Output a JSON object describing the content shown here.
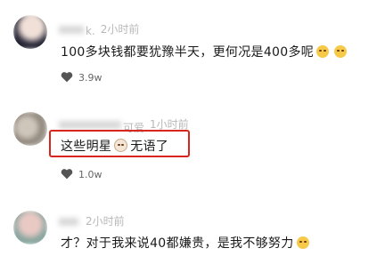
{
  "comments": [
    {
      "name": "k.",
      "time": "2小时前",
      "text_before": "100多块钱都要犹豫半天，更何况是400多呢",
      "text_after": "",
      "emojis": [
        "laugh-cry-emoji",
        "laugh-cry-emoji"
      ],
      "likes": "3.9w"
    },
    {
      "name": "可爱",
      "time": "1小时前",
      "text_before": "这些明星",
      "text_after": "无语了",
      "emojis": [
        "cat-emoji"
      ],
      "likes": "1.0w",
      "highlighted": true
    },
    {
      "name": "",
      "time": "2小时前",
      "text_before": "才？对于我来说40都嫌贵，是我不够努力",
      "text_after": "",
      "emojis": [
        "laugh-cry-emoji"
      ],
      "likes": ""
    }
  ],
  "colors": {
    "highlight_border": "#d8261f",
    "meta_text": "#b8b8b8"
  }
}
